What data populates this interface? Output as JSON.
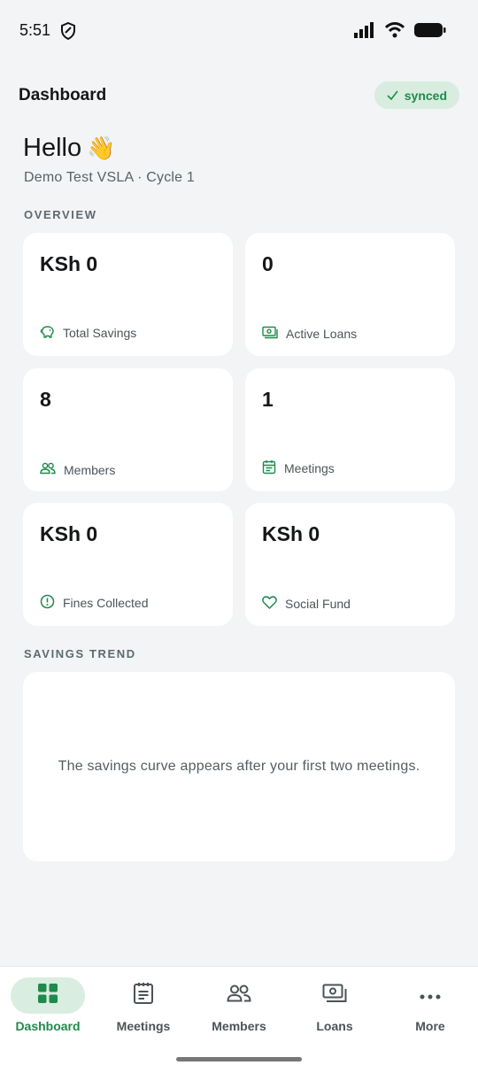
{
  "status_bar": {
    "time": "5:51"
  },
  "header": {
    "title": "Dashboard",
    "sync_label": "synced"
  },
  "greeting": {
    "hello": "Hello",
    "emoji": "👋",
    "subtitle": "Demo Test VSLA · Cycle 1"
  },
  "overview": {
    "section_label": "OVERVIEW",
    "cards": [
      {
        "value": "KSh 0",
        "label": "Total Savings",
        "icon": "piggy-bank-icon"
      },
      {
        "value": "0",
        "label": "Active Loans",
        "icon": "cash-icon"
      },
      {
        "value": "8",
        "label": "Members",
        "icon": "people-icon"
      },
      {
        "value": "1",
        "label": "Meetings",
        "icon": "calendar-icon"
      },
      {
        "value": "KSh 0",
        "label": "Fines Collected",
        "icon": "alert-circle-icon"
      },
      {
        "value": "KSh 0",
        "label": "Social Fund",
        "icon": "heart-icon"
      }
    ]
  },
  "savings_trend": {
    "section_label": "SAVINGS TREND",
    "empty_message": "The savings curve appears after your first two meetings."
  },
  "bottom_nav": {
    "items": [
      {
        "label": "Dashboard",
        "icon": "grid-icon",
        "active": true
      },
      {
        "label": "Meetings",
        "icon": "notes-icon",
        "active": false
      },
      {
        "label": "Members",
        "icon": "people-icon",
        "active": false
      },
      {
        "label": "Loans",
        "icon": "cash-icon",
        "active": false
      },
      {
        "label": "More",
        "icon": "more-horizontal-icon",
        "active": false
      }
    ]
  },
  "colors": {
    "accent": "#1f8a4c",
    "accent_light": "#d9ede0",
    "background": "#f2f4f5"
  }
}
